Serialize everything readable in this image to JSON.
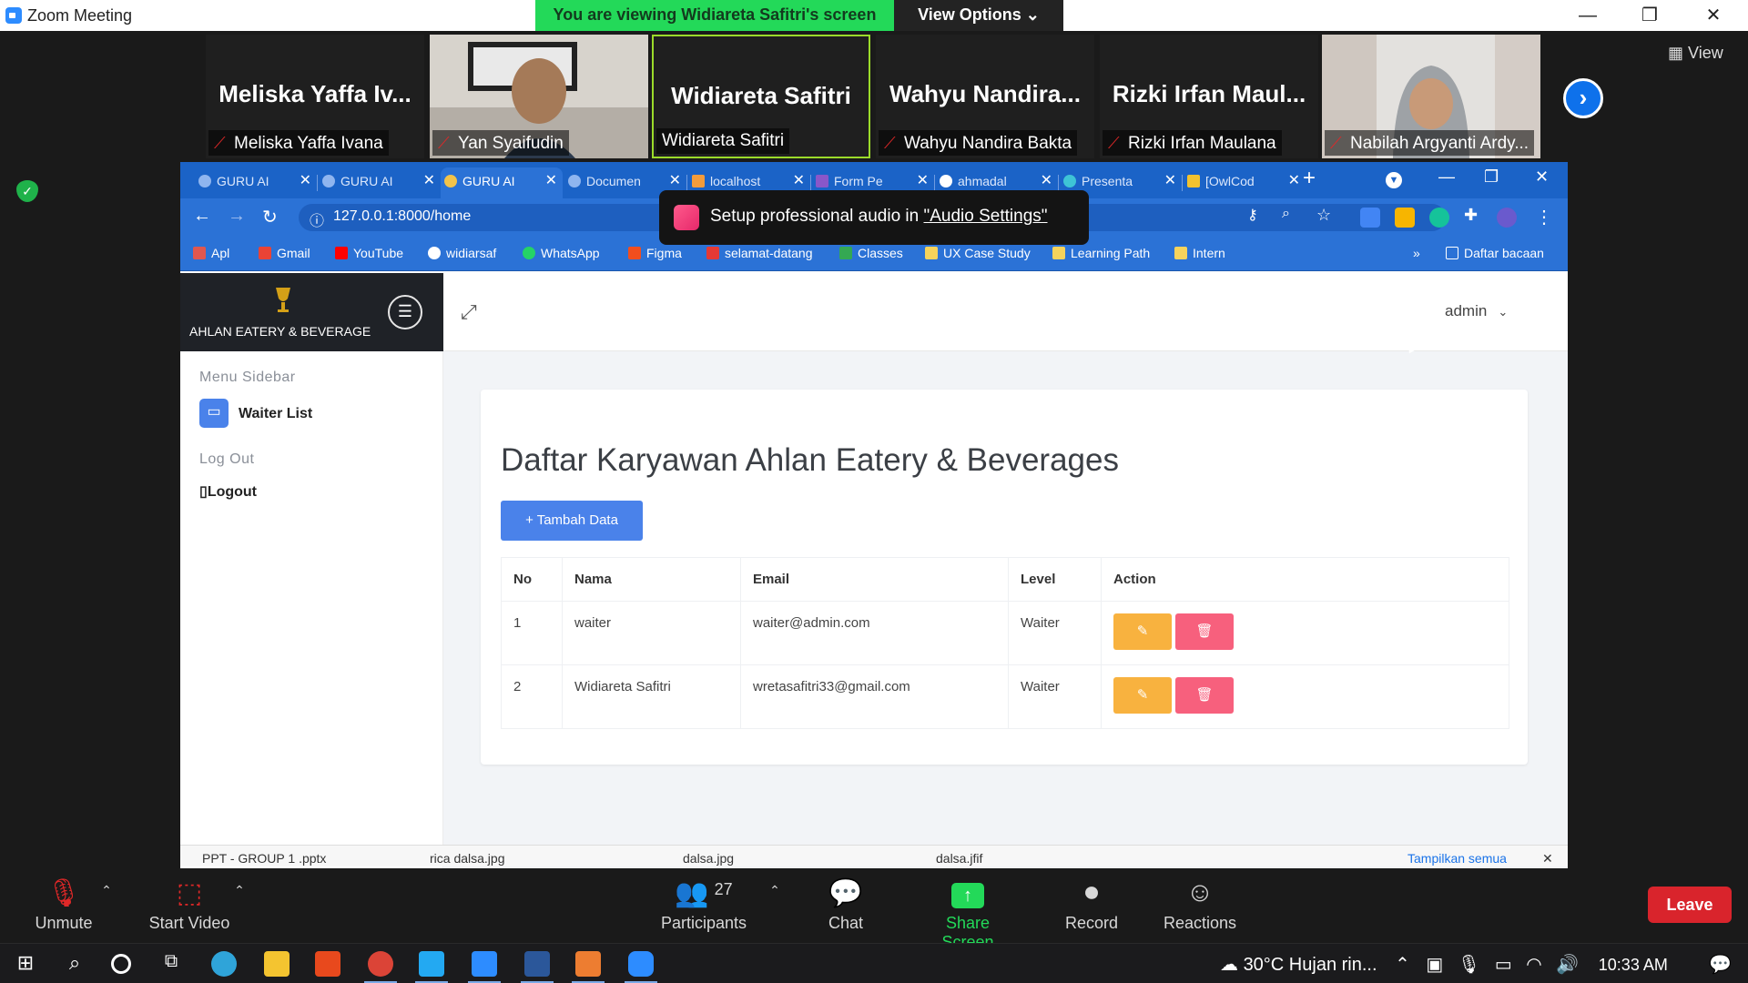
{
  "zoom": {
    "window_title": "Zoom Meeting",
    "viewing_banner": "You are viewing Widiareta Safitri's screen",
    "view_options": "View Options ⌄",
    "view_button": "View",
    "participants": [
      {
        "big_name": "Meliska Yaffa Iv...",
        "label": "Meliska Yaffa Ivana",
        "video": false
      },
      {
        "big_name": "",
        "label": "Yan Syaifudin",
        "video": true
      },
      {
        "big_name": "Widiareta Safitri",
        "label": "Widiareta Safitri",
        "video": false,
        "active": true
      },
      {
        "big_name": "Wahyu Nandira...",
        "label": "Wahyu Nandira Bakta",
        "video": false
      },
      {
        "big_name": "Rizki Irfan Maul...",
        "label": "Rizki Irfan Maulana",
        "video": false
      },
      {
        "big_name": "",
        "label": "Nabilah Argyanti Ardy...",
        "video": true
      }
    ],
    "controls": {
      "unmute": "Unmute",
      "start_video": "Start Video",
      "participants": "Participants",
      "participants_count": "27",
      "chat": "Chat",
      "share_screen": "Share Screen",
      "record": "Record",
      "reactions": "Reactions",
      "leave": "Leave"
    },
    "accent": "#23d959",
    "leave_color": "#d9242c"
  },
  "browser": {
    "tabs": [
      "GURU AI",
      "GURU AI",
      "GURU AI",
      "Documen",
      "localhost",
      "Form Pe",
      "ahmadal",
      "Presenta",
      "[OwlCod"
    ],
    "url": "127.0.0.1:8000/home",
    "bookmarks": [
      "Apl",
      "Gmail",
      "YouTube",
      "widiarsaf",
      "WhatsApp",
      "Figma",
      "selamat-datang",
      "Classes",
      "UX Case Study",
      "Learning Path",
      "Intern"
    ],
    "more_bookmarks": "»",
    "reading_list": "Daftar bacaan",
    "notification": {
      "text": "Setup professional audio in ",
      "link": "\"Audio Settings\""
    },
    "downloads": [
      "PPT - GROUP 1 .pptx",
      "rica dalsa.jpg",
      "dalsa.jpg",
      "dalsa.jfif"
    ],
    "show_all": "Tampilkan semua",
    "tab_color": "#2b72d6"
  },
  "app": {
    "brand": "AHLAN EATERY & BEVERAGE",
    "user_menu": "admin",
    "sidebar": {
      "heading_menu": "Menu Sidebar",
      "waiter_list": "Waiter List",
      "heading_logout": "Log Out",
      "logout": "Logout"
    },
    "title": "Daftar Karyawan Ahlan Eatery & Beverages",
    "add_button": "+ Tambah Data",
    "table": {
      "headers": [
        "No",
        "Nama",
        "Email",
        "Level",
        "Action"
      ],
      "rows": [
        [
          "1",
          "waiter",
          "waiter@admin.com",
          "Waiter"
        ],
        [
          "2",
          "Widiareta Safitri",
          "wretasafitri33@gmail.com",
          "Waiter"
        ]
      ]
    },
    "primary_color": "#4a82ea",
    "edit_color": "#f8b23f",
    "delete_color": "#f7607d"
  },
  "taskbar": {
    "weather": "30°C Hujan rin...",
    "time": "10:33 AM"
  }
}
